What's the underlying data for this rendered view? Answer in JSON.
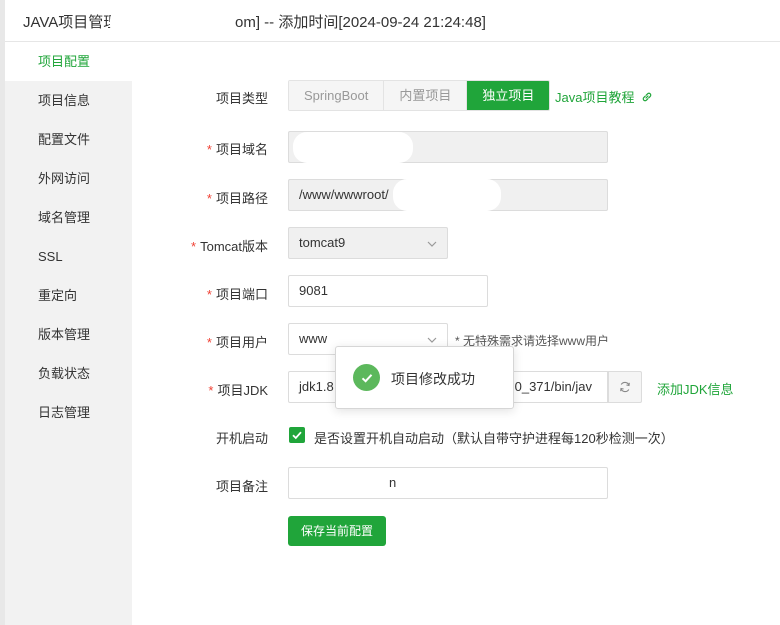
{
  "window": {
    "title_left": "JAVA项目管理",
    "title_right": "om] -- 添加时间[2024-09-24 21:24:48]"
  },
  "sidebar": {
    "items": [
      {
        "label": "项目配置",
        "active": true
      },
      {
        "label": "项目信息"
      },
      {
        "label": "配置文件"
      },
      {
        "label": "外网访问"
      },
      {
        "label": "域名管理"
      },
      {
        "label": "SSL"
      },
      {
        "label": "重定向"
      },
      {
        "label": "版本管理"
      },
      {
        "label": "负载状态"
      },
      {
        "label": "日志管理"
      }
    ]
  },
  "form": {
    "project_type": {
      "label": "项目类型",
      "options": [
        "SpringBoot",
        "内置项目",
        "独立项目"
      ],
      "selected": "独立项目",
      "tutorial_link": "Java项目教程"
    },
    "domain": {
      "label": "项目域名",
      "value": ""
    },
    "path": {
      "label": "项目路径",
      "value": "/www/wwwroot/"
    },
    "tomcat": {
      "label": "Tomcat版本",
      "value": "tomcat9"
    },
    "port": {
      "label": "项目端口",
      "value": "9081"
    },
    "user": {
      "label": "项目用户",
      "value": "www",
      "hint": "* 无特殊需求请选择www用户"
    },
    "jdk": {
      "label": "项目JDK",
      "value_left": "jdk1.8",
      "value_right": ".0_371/bin/jav",
      "add_link": "添加JDK信息"
    },
    "autostart": {
      "label": "开机启动",
      "checked": true,
      "text": "是否设置开机自动启动（默认自带守护进程每120秒检测一次）"
    },
    "remark": {
      "label": "项目备注",
      "value": "n"
    },
    "save_label": "保存当前配置"
  },
  "toast": {
    "message": "项目修改成功"
  },
  "colors": {
    "accent": "#20a53a",
    "required": "#f04134",
    "toast_icon": "#5cb85c"
  }
}
